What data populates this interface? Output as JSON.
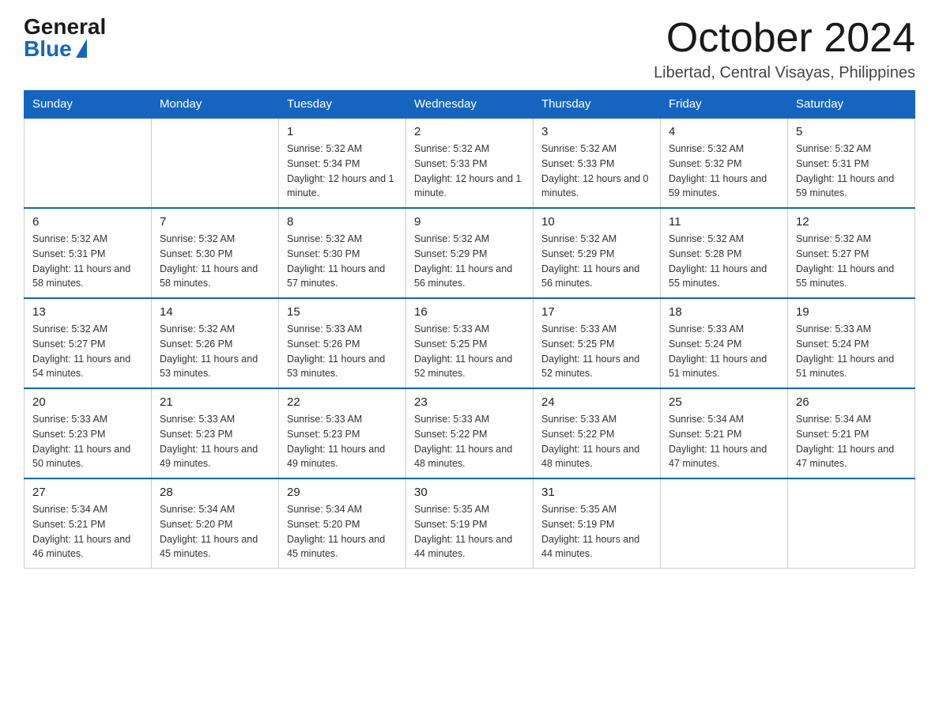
{
  "logo": {
    "general": "General",
    "blue": "Blue"
  },
  "header": {
    "month_year": "October 2024",
    "location": "Libertad, Central Visayas, Philippines"
  },
  "days_of_week": [
    "Sunday",
    "Monday",
    "Tuesday",
    "Wednesday",
    "Thursday",
    "Friday",
    "Saturday"
  ],
  "weeks": [
    [
      {
        "day": "",
        "sunrise": "",
        "sunset": "",
        "daylight": ""
      },
      {
        "day": "",
        "sunrise": "",
        "sunset": "",
        "daylight": ""
      },
      {
        "day": "1",
        "sunrise": "Sunrise: 5:32 AM",
        "sunset": "Sunset: 5:34 PM",
        "daylight": "Daylight: 12 hours and 1 minute."
      },
      {
        "day": "2",
        "sunrise": "Sunrise: 5:32 AM",
        "sunset": "Sunset: 5:33 PM",
        "daylight": "Daylight: 12 hours and 1 minute."
      },
      {
        "day": "3",
        "sunrise": "Sunrise: 5:32 AM",
        "sunset": "Sunset: 5:33 PM",
        "daylight": "Daylight: 12 hours and 0 minutes."
      },
      {
        "day": "4",
        "sunrise": "Sunrise: 5:32 AM",
        "sunset": "Sunset: 5:32 PM",
        "daylight": "Daylight: 11 hours and 59 minutes."
      },
      {
        "day": "5",
        "sunrise": "Sunrise: 5:32 AM",
        "sunset": "Sunset: 5:31 PM",
        "daylight": "Daylight: 11 hours and 59 minutes."
      }
    ],
    [
      {
        "day": "6",
        "sunrise": "Sunrise: 5:32 AM",
        "sunset": "Sunset: 5:31 PM",
        "daylight": "Daylight: 11 hours and 58 minutes."
      },
      {
        "day": "7",
        "sunrise": "Sunrise: 5:32 AM",
        "sunset": "Sunset: 5:30 PM",
        "daylight": "Daylight: 11 hours and 58 minutes."
      },
      {
        "day": "8",
        "sunrise": "Sunrise: 5:32 AM",
        "sunset": "Sunset: 5:30 PM",
        "daylight": "Daylight: 11 hours and 57 minutes."
      },
      {
        "day": "9",
        "sunrise": "Sunrise: 5:32 AM",
        "sunset": "Sunset: 5:29 PM",
        "daylight": "Daylight: 11 hours and 56 minutes."
      },
      {
        "day": "10",
        "sunrise": "Sunrise: 5:32 AM",
        "sunset": "Sunset: 5:29 PM",
        "daylight": "Daylight: 11 hours and 56 minutes."
      },
      {
        "day": "11",
        "sunrise": "Sunrise: 5:32 AM",
        "sunset": "Sunset: 5:28 PM",
        "daylight": "Daylight: 11 hours and 55 minutes."
      },
      {
        "day": "12",
        "sunrise": "Sunrise: 5:32 AM",
        "sunset": "Sunset: 5:27 PM",
        "daylight": "Daylight: 11 hours and 55 minutes."
      }
    ],
    [
      {
        "day": "13",
        "sunrise": "Sunrise: 5:32 AM",
        "sunset": "Sunset: 5:27 PM",
        "daylight": "Daylight: 11 hours and 54 minutes."
      },
      {
        "day": "14",
        "sunrise": "Sunrise: 5:32 AM",
        "sunset": "Sunset: 5:26 PM",
        "daylight": "Daylight: 11 hours and 53 minutes."
      },
      {
        "day": "15",
        "sunrise": "Sunrise: 5:33 AM",
        "sunset": "Sunset: 5:26 PM",
        "daylight": "Daylight: 11 hours and 53 minutes."
      },
      {
        "day": "16",
        "sunrise": "Sunrise: 5:33 AM",
        "sunset": "Sunset: 5:25 PM",
        "daylight": "Daylight: 11 hours and 52 minutes."
      },
      {
        "day": "17",
        "sunrise": "Sunrise: 5:33 AM",
        "sunset": "Sunset: 5:25 PM",
        "daylight": "Daylight: 11 hours and 52 minutes."
      },
      {
        "day": "18",
        "sunrise": "Sunrise: 5:33 AM",
        "sunset": "Sunset: 5:24 PM",
        "daylight": "Daylight: 11 hours and 51 minutes."
      },
      {
        "day": "19",
        "sunrise": "Sunrise: 5:33 AM",
        "sunset": "Sunset: 5:24 PM",
        "daylight": "Daylight: 11 hours and 51 minutes."
      }
    ],
    [
      {
        "day": "20",
        "sunrise": "Sunrise: 5:33 AM",
        "sunset": "Sunset: 5:23 PM",
        "daylight": "Daylight: 11 hours and 50 minutes."
      },
      {
        "day": "21",
        "sunrise": "Sunrise: 5:33 AM",
        "sunset": "Sunset: 5:23 PM",
        "daylight": "Daylight: 11 hours and 49 minutes."
      },
      {
        "day": "22",
        "sunrise": "Sunrise: 5:33 AM",
        "sunset": "Sunset: 5:23 PM",
        "daylight": "Daylight: 11 hours and 49 minutes."
      },
      {
        "day": "23",
        "sunrise": "Sunrise: 5:33 AM",
        "sunset": "Sunset: 5:22 PM",
        "daylight": "Daylight: 11 hours and 48 minutes."
      },
      {
        "day": "24",
        "sunrise": "Sunrise: 5:33 AM",
        "sunset": "Sunset: 5:22 PM",
        "daylight": "Daylight: 11 hours and 48 minutes."
      },
      {
        "day": "25",
        "sunrise": "Sunrise: 5:34 AM",
        "sunset": "Sunset: 5:21 PM",
        "daylight": "Daylight: 11 hours and 47 minutes."
      },
      {
        "day": "26",
        "sunrise": "Sunrise: 5:34 AM",
        "sunset": "Sunset: 5:21 PM",
        "daylight": "Daylight: 11 hours and 47 minutes."
      }
    ],
    [
      {
        "day": "27",
        "sunrise": "Sunrise: 5:34 AM",
        "sunset": "Sunset: 5:21 PM",
        "daylight": "Daylight: 11 hours and 46 minutes."
      },
      {
        "day": "28",
        "sunrise": "Sunrise: 5:34 AM",
        "sunset": "Sunset: 5:20 PM",
        "daylight": "Daylight: 11 hours and 45 minutes."
      },
      {
        "day": "29",
        "sunrise": "Sunrise: 5:34 AM",
        "sunset": "Sunset: 5:20 PM",
        "daylight": "Daylight: 11 hours and 45 minutes."
      },
      {
        "day": "30",
        "sunrise": "Sunrise: 5:35 AM",
        "sunset": "Sunset: 5:19 PM",
        "daylight": "Daylight: 11 hours and 44 minutes."
      },
      {
        "day": "31",
        "sunrise": "Sunrise: 5:35 AM",
        "sunset": "Sunset: 5:19 PM",
        "daylight": "Daylight: 11 hours and 44 minutes."
      },
      {
        "day": "",
        "sunrise": "",
        "sunset": "",
        "daylight": ""
      },
      {
        "day": "",
        "sunrise": "",
        "sunset": "",
        "daylight": ""
      }
    ]
  ]
}
